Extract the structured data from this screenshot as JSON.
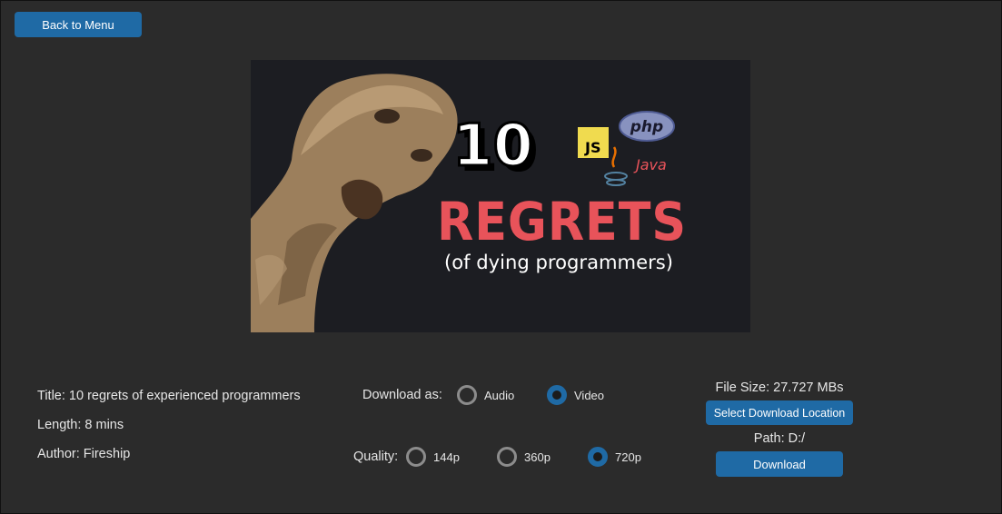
{
  "back_button": {
    "label": "Back to Menu"
  },
  "thumbnail": {
    "number": "10",
    "headline": "REGRETS",
    "subtitle": "(of dying programmers)",
    "logos": [
      "JS",
      "php",
      "Java"
    ]
  },
  "video_info": {
    "title": "Title: 10 regrets of experienced programmers",
    "length": "Length: 8 mins",
    "author": "Author: Fireship"
  },
  "download_as": {
    "label": "Download as:",
    "options": [
      {
        "label": "Audio",
        "selected": false
      },
      {
        "label": "Video",
        "selected": true
      }
    ]
  },
  "quality": {
    "label": "Quality:",
    "options": [
      {
        "label": "144p",
        "selected": false
      },
      {
        "label": "360p",
        "selected": false
      },
      {
        "label": "720p",
        "selected": true
      }
    ]
  },
  "download_panel": {
    "file_size": "File Size: 27.727 MBs",
    "select_location_label": "Select Download Location",
    "path": "Path: D:/",
    "download_label": "Download"
  },
  "colors": {
    "accent": "#1f6aa5",
    "background": "#2b2b2b",
    "headline_red": "#e8535a",
    "js_yellow": "#f0db4f"
  }
}
